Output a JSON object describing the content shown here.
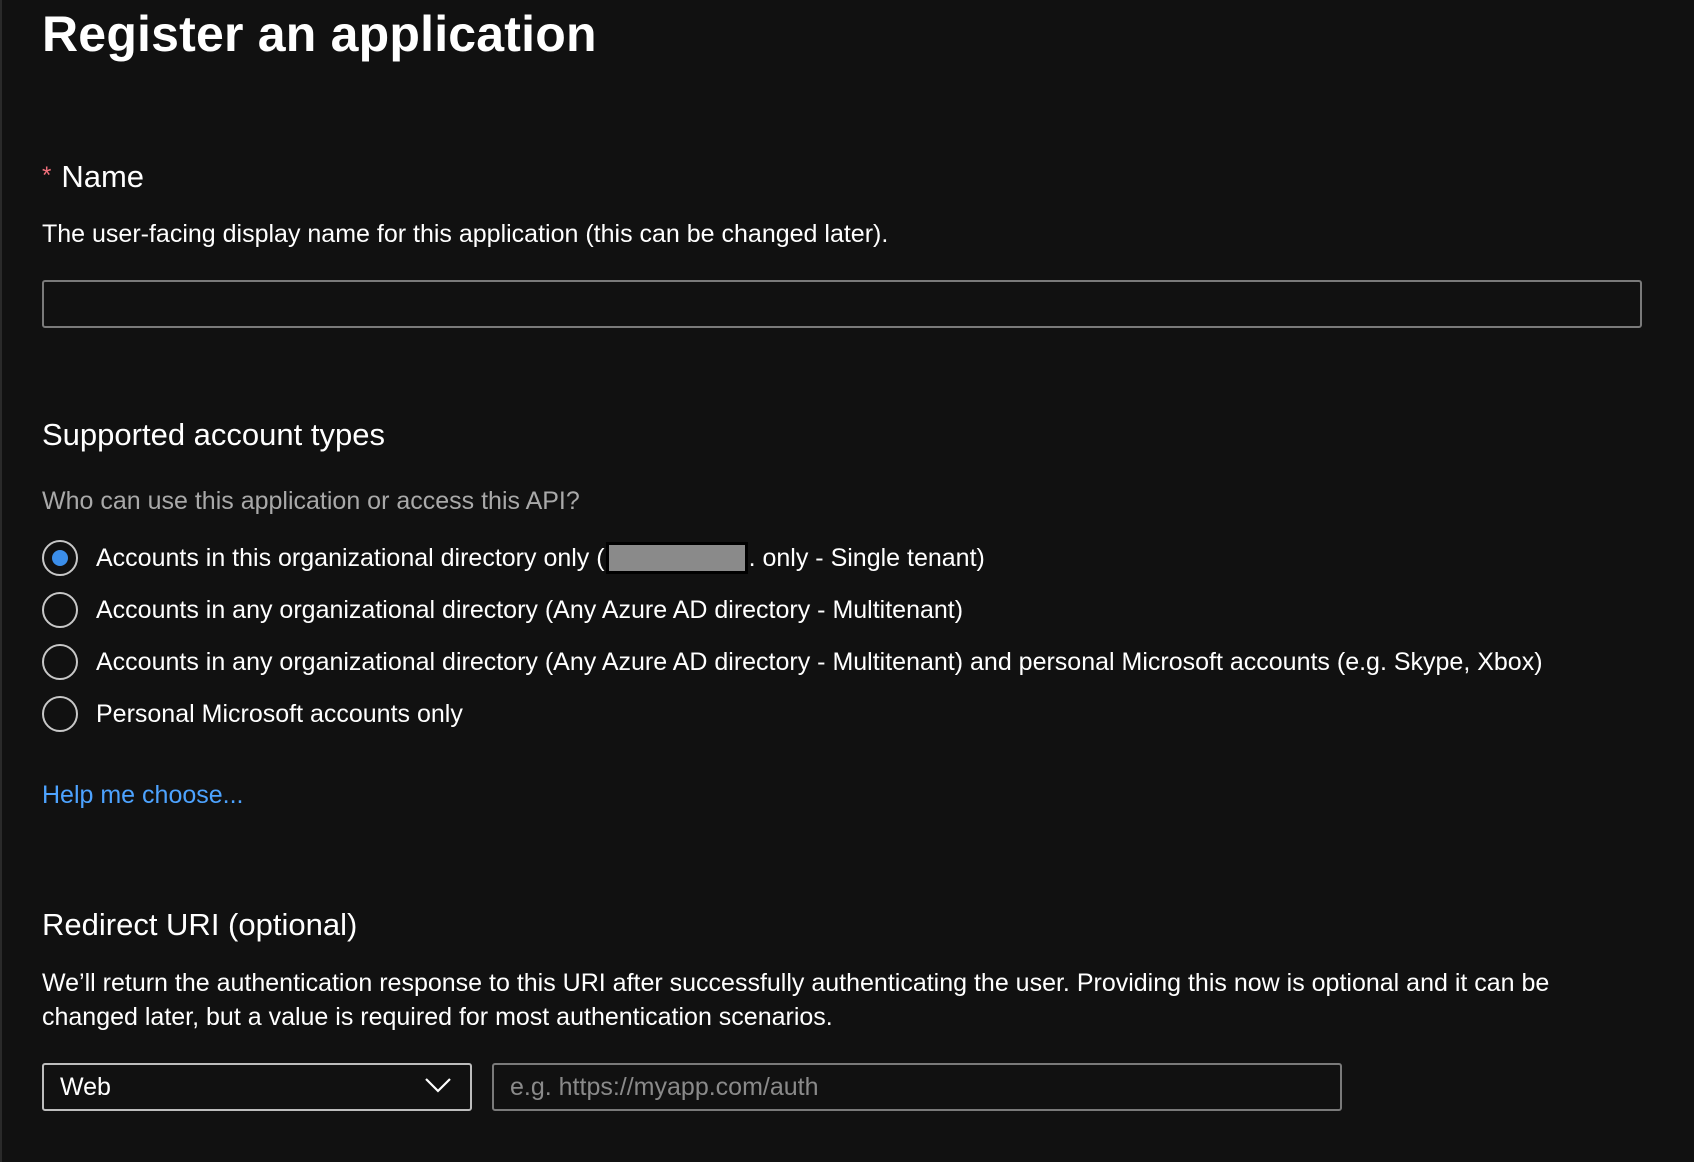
{
  "page": {
    "title": "Register an application"
  },
  "name_section": {
    "required_marker": "*",
    "label": "Name",
    "description": "The user-facing display name for this application (this can be changed later).",
    "value": ""
  },
  "account_types": {
    "heading": "Supported account types",
    "question": "Who can use this application or access this API?",
    "options": [
      {
        "label_before": "Accounts in this organizational directory only (",
        "label_after": ". only - Single tenant)",
        "redacted": true,
        "selected": true
      },
      {
        "label": "Accounts in any organizational directory (Any Azure AD directory - Multitenant)",
        "selected": false
      },
      {
        "label": "Accounts in any organizational directory (Any Azure AD directory - Multitenant) and personal Microsoft accounts (e.g. Skype, Xbox)",
        "selected": false
      },
      {
        "label": "Personal Microsoft accounts only",
        "selected": false
      }
    ],
    "help_link": "Help me choose..."
  },
  "redirect_uri": {
    "heading": "Redirect URI (optional)",
    "description": "We’ll return the authentication response to this URI after successfully authenticating the user. Providing this now is optional and it can be changed later, but a value is required for most authentication scenarios.",
    "platform_selected": "Web",
    "uri_placeholder": "e.g. https://myapp.com/auth",
    "uri_value": ""
  },
  "colors": {
    "background": "#111111",
    "text": "#ffffff",
    "muted_text": "#a9a9a9",
    "link": "#4da3ff",
    "radio_selected": "#3b8eea",
    "required": "#f1707b"
  },
  "icons": {
    "select_chevron": "chevron-down-icon"
  }
}
